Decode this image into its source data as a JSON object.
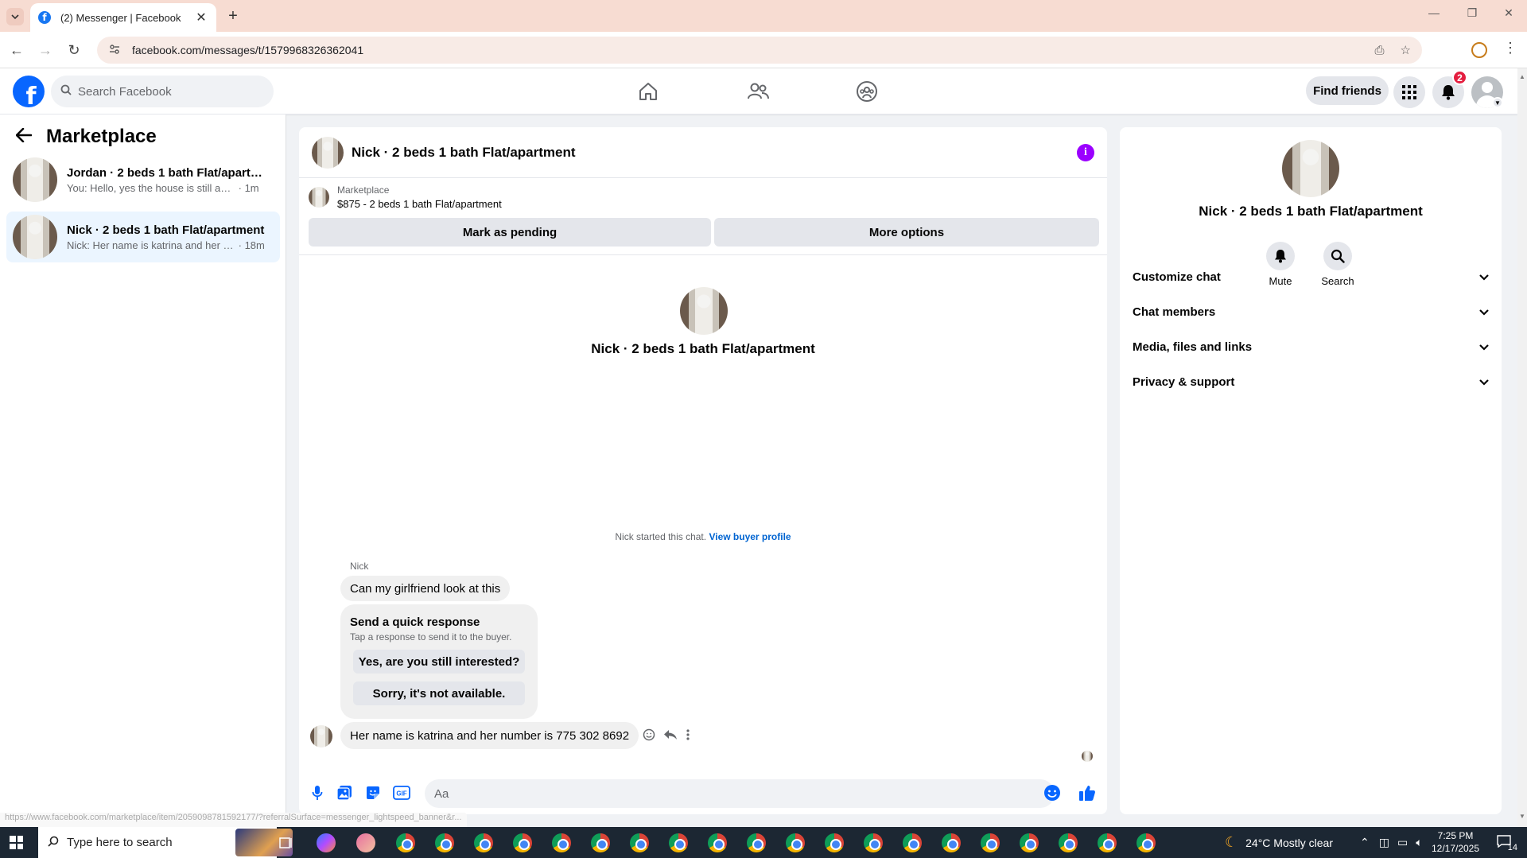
{
  "browser": {
    "tab_title": "(2) Messenger | Facebook",
    "url": "facebook.com/messages/t/1579968326362041",
    "status_url": "https://www.facebook.com/marketplace/item/2059098781592177/?referralSurface=messenger_lightspeed_banner&r..."
  },
  "fb_nav": {
    "search_placeholder": "Search Facebook",
    "find_friends": "Find friends",
    "notification_count": "2"
  },
  "sidebar": {
    "title": "Marketplace",
    "conversations": [
      {
        "name": "Jordan · 2 beds 1 bath Flat/apartm...",
        "snippet": "You: Hello, yes the house is still availa...",
        "time": "· 1m",
        "active": false
      },
      {
        "name": "Nick · 2 beds 1 bath Flat/apartment",
        "snippet": "Nick: Her name is katrina and her n...",
        "time": "· 18m",
        "active": true
      }
    ]
  },
  "chat": {
    "title": "Nick · 2 beds 1 bath Flat/apartment",
    "listing_label": "Marketplace",
    "listing_price": "$875 - 2 beds 1 bath Flat/apartment",
    "mark_pending": "Mark as pending",
    "more_options": "More options",
    "intro_title": "Nick · 2 beds 1 bath Flat/apartment",
    "started_text": "Nick started this chat.",
    "view_profile": "View buyer profile",
    "sender": "Nick",
    "message1": "Can my girlfriend look at this",
    "quick_title": "Send a quick response",
    "quick_sub": "Tap a response to send it to the buyer.",
    "quick_reply1": "Yes, are you still interested?",
    "quick_reply2": "Sorry, it's not available.",
    "message2": "Her name is katrina and her number is 775 302 8692",
    "composer_placeholder": "Aa"
  },
  "details": {
    "title": "Nick · 2 beds 1 bath Flat/apartment",
    "mute": "Mute",
    "search": "Search",
    "sections": [
      "Customize chat",
      "Chat members",
      "Media, files and links",
      "Privacy & support"
    ]
  },
  "taskbar": {
    "search_placeholder": "Type here to search",
    "weather": "24°C  Mostly clear",
    "time": "7:25 PM",
    "date": "12/17/2025",
    "notifications": "14"
  },
  "colors": {
    "fb_blue": "#0866ff",
    "link_blue": "#0064d1",
    "info_purple": "#9b00ff",
    "active_conv": "#ebf5ff",
    "badge_red": "#e41e3f"
  }
}
